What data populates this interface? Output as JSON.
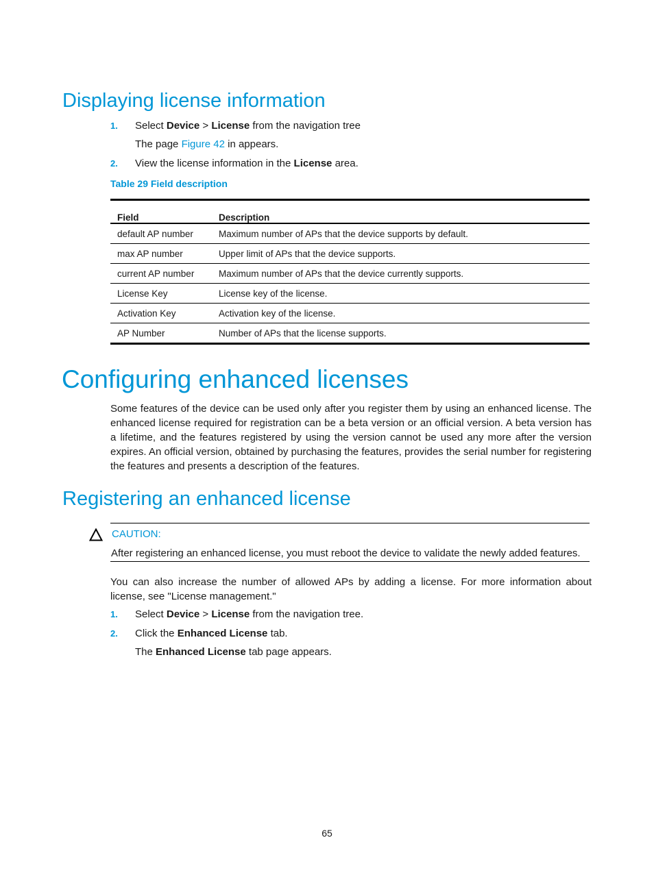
{
  "section1": {
    "heading": "Displaying license information",
    "steps": [
      {
        "num": "1.",
        "parts": [
          "Select ",
          "Device",
          " > ",
          "License",
          " from the navigation tree"
        ],
        "sub_parts": [
          "The page ",
          "Figure 42",
          " in appears."
        ]
      },
      {
        "num": "2.",
        "parts": [
          "View the license information in the ",
          "License",
          " area."
        ]
      }
    ],
    "table_caption": "Table 29 Field description",
    "table": {
      "headers": [
        "Field",
        "Description"
      ],
      "rows": [
        [
          "default AP number",
          "Maximum number of APs that the device supports by default."
        ],
        [
          "max AP number",
          "Upper limit of APs that the device supports."
        ],
        [
          "current AP number",
          "Maximum number of APs that the device currently supports."
        ],
        [
          "License Key",
          "License key of the license."
        ],
        [
          "Activation Key",
          "Activation key of the license."
        ],
        [
          "AP Number",
          "Number of APs that the license supports."
        ]
      ]
    }
  },
  "chapter": {
    "heading": "Configuring enhanced licenses",
    "paragraph": "Some features of the device can be used only after you register them by using an enhanced license. The enhanced license required for registration can be a beta version or an official version. A beta version has a lifetime, and the features registered by using the version cannot be used any more after the version expires. An official version, obtained by purchasing the features, provides the serial number for registering the features and presents a description of the features."
  },
  "section2": {
    "heading": "Registering an enhanced license",
    "caution": {
      "icon": "warning-triangle-icon",
      "label": "CAUTION:",
      "text": "After registering an enhanced license, you must reboot the device to validate the newly added features."
    },
    "paragraph": "You can also increase the number of allowed APs by adding a license. For more information about license, see \"License management.\"",
    "steps": [
      {
        "num": "1.",
        "parts": [
          "Select ",
          "Device",
          " > ",
          "License",
          " from the navigation tree."
        ]
      },
      {
        "num": "2.",
        "parts": [
          "Click the ",
          "Enhanced License",
          " tab."
        ],
        "sub_parts": [
          "The ",
          "Enhanced License",
          " tab page appears."
        ]
      }
    ]
  },
  "footer": {
    "page_number": "65"
  }
}
